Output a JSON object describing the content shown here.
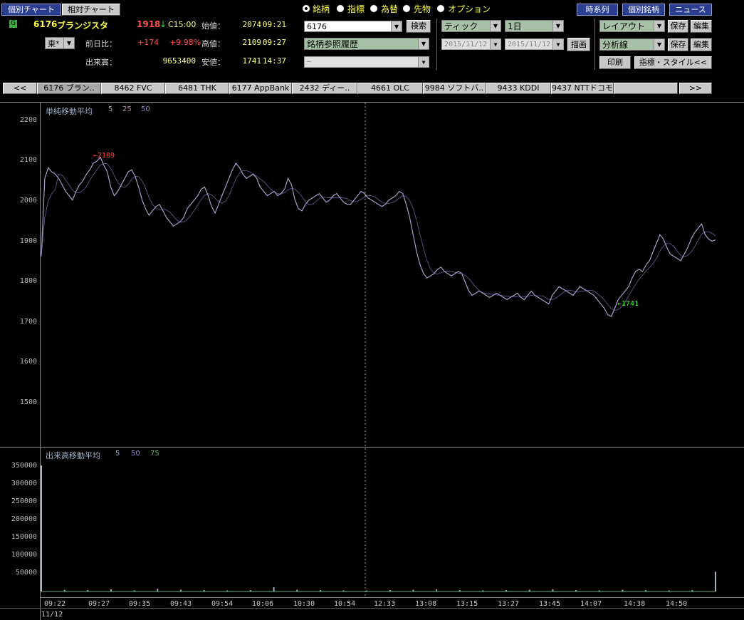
{
  "top_tabs": {
    "individual": "個別チャート",
    "relative": "相対チャート"
  },
  "stock": {
    "code": "6176",
    "name": "ブランジスタ",
    "price": "1918",
    "arrow": "↓",
    "close_time": "C15:00",
    "market": "東*",
    "prev_label": "前日比：",
    "change": "+174",
    "change_pct": "+9.98%",
    "volume_label": "出来高：",
    "volume": "9653400",
    "open_label": "始値：",
    "open": "2074",
    "open_time": "09:21",
    "high_label": "高値：",
    "high": "2109",
    "high_time": "09:27",
    "low_label": "安値：",
    "low": "1741",
    "low_time": "14:37"
  },
  "radios": [
    {
      "label": "銘柄",
      "selected": true
    },
    {
      "label": "指標",
      "selected": false
    },
    {
      "label": "為替",
      "selected": false
    },
    {
      "label": "先物",
      "selected": false
    },
    {
      "label": "オプション",
      "selected": false
    }
  ],
  "search": {
    "value": "6176",
    "button": "検索",
    "history": "銘柄参照履歴",
    "third": "─"
  },
  "period": {
    "type": "ティック",
    "range": "1日",
    "from": "2015/11/12",
    "to": "2015/11/12",
    "draw": "描画"
  },
  "right_buttons": {
    "timeseries": "時系列",
    "individual": "個別銘柄",
    "news": "ニュース",
    "layout": "レイアウト",
    "analysis": "分析線",
    "save": "保存",
    "edit": "編集",
    "print": "印刷",
    "indicator_style": "指標・スタイル<<"
  },
  "stock_tabs": [
    "6176 ブラン..",
    "8462 FVC",
    "6481 THK",
    "6177 AppBank",
    "2432 ディー..",
    "4661 OLC",
    "9984 ソフトバ..",
    "9433 KDDI",
    "9437 NTTドコモ",
    ""
  ],
  "tab_nav": {
    "prev": "<<",
    "next": ">>"
  },
  "chart_data": [
    {
      "type": "line",
      "title": "単純移動平均",
      "ma_periods": [
        "5",
        "25",
        "50"
      ],
      "ma_colors": [
        "#9fb0c8",
        "#c090b8",
        "#8f8fd8"
      ],
      "y_ticks": [
        2200,
        2100,
        2000,
        1900,
        1800,
        1700,
        1600,
        1500
      ],
      "ylim": [
        1440,
        2235
      ],
      "annotations": [
        {
          "text": "←2109",
          "color": "#ff4040"
        },
        {
          "text": "←1741",
          "color": "#40ff40"
        }
      ],
      "series": [
        {
          "name": "price",
          "values": [
            1880,
            2060,
            2085,
            2075,
            2070,
            2060,
            2045,
            2030,
            2020,
            2010,
            2030,
            2045,
            2055,
            2070,
            2080,
            2095,
            2100,
            2109,
            2090,
            2075,
            2040,
            2020,
            2030,
            2045,
            2060,
            2075,
            2080,
            2065,
            2040,
            2010,
            1990,
            1975,
            1985,
            1995,
            2000,
            1985,
            1970,
            1960,
            1950,
            1955,
            1960,
            1970,
            1990,
            2000,
            2010,
            2020,
            2035,
            2040,
            2020,
            1995,
            1980,
            2000,
            2020,
            2040,
            2060,
            2080,
            2095,
            2085,
            2070,
            2060,
            2065,
            2070,
            2060,
            2040,
            2030,
            2020,
            2025,
            2030,
            2020,
            2025,
            2035,
            2060,
            2045,
            2010,
            1990,
            1985,
            2000,
            2010,
            2015,
            2020,
            2025,
            2015,
            2005,
            2010,
            2020,
            2025,
            2015,
            2005,
            2000,
            2000,
            2010,
            2020,
            2030,
            2025,
            2015,
            2010,
            2005,
            2000,
            1995,
            2000,
            2010,
            2015,
            2020,
            2030,
            2025,
            2000,
            1970,
            1930,
            1890,
            1860,
            1840,
            1830,
            1835,
            1840,
            1850,
            1855,
            1845,
            1840,
            1835,
            1840,
            1845,
            1840,
            1820,
            1800,
            1790,
            1795,
            1800,
            1795,
            1790,
            1785,
            1790,
            1795,
            1790,
            1785,
            1780,
            1785,
            1790,
            1795,
            1785,
            1780,
            1790,
            1800,
            1790,
            1785,
            1780,
            1775,
            1770,
            1790,
            1800,
            1810,
            1805,
            1800,
            1795,
            1790,
            1800,
            1810,
            1805,
            1800,
            1795,
            1790,
            1780,
            1770,
            1760,
            1745,
            1741,
            1760,
            1780,
            1790,
            1800,
            1810,
            1830,
            1845,
            1850,
            1845,
            1860,
            1870,
            1890,
            1910,
            1930,
            1920,
            1900,
            1885,
            1880,
            1875,
            1870,
            1885,
            1900,
            1920,
            1935,
            1945,
            1955,
            1930,
            1920,
            1915,
            1918
          ]
        }
      ]
    },
    {
      "type": "bar",
      "title": "出来高移動平均",
      "ma_periods": [
        "5",
        "50",
        "75"
      ],
      "ma_colors": [
        "#9fb0c8",
        "#8f8fd8",
        "#70b070"
      ],
      "y_ticks": [
        350000,
        300000,
        250000,
        200000,
        150000,
        100000,
        50000
      ],
      "ylim": [
        0,
        368000
      ],
      "x_labels": [
        "09:22",
        "09:27",
        "09:35",
        "09:43",
        "09:54",
        "10:06",
        "10:30",
        "10:54",
        "12:33",
        "13:08",
        "13:15",
        "13:27",
        "13:45",
        "14:07",
        "14:38",
        "14:50"
      ],
      "date": "11/12",
      "series": [
        {
          "name": "volume",
          "values": [
            350000,
            5000,
            4000,
            6000,
            3000,
            8000,
            5000,
            4000,
            3000,
            4000,
            12000,
            5000,
            4000,
            3000,
            3000,
            4000,
            5000,
            6000,
            4000,
            3000,
            4000,
            5000,
            6000,
            4000,
            3000,
            5000,
            4000,
            3000,
            4000,
            55000
          ]
        }
      ]
    }
  ]
}
